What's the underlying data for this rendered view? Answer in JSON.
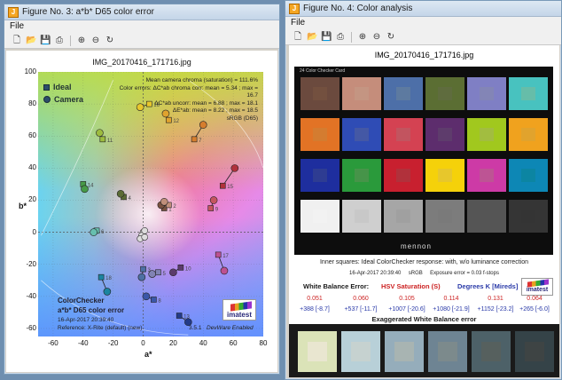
{
  "fig3": {
    "window_title": "Figure No. 3: a*b* D65 color error",
    "menu_file": "File",
    "plot_title": "IMG_20170416_171716.jpg",
    "legend_ideal": "Ideal",
    "legend_camera": "Camera",
    "info_lines": [
      "Mean camera chroma (saturation) = 111.6%",
      "Color errors:  ΔC*ab chroma corr:  mean = 5.34 ;  max = 16.7",
      "ΔC*ab uncorr:  mean = 6.88 ;  max = 18.1",
      "ΔE*ab:  mean = 8.22 ;  max = 18.5",
      "sRGB (D65)"
    ],
    "x_axis_label": "a*",
    "y_axis_label": "b*",
    "x_ticks": [
      "-60",
      "-40",
      "-20",
      "0",
      "20",
      "40",
      "60",
      "80"
    ],
    "y_ticks": [
      "100",
      "80",
      "60",
      "40",
      "20",
      "0",
      "-20",
      "-40",
      "-60"
    ],
    "cc_title": "ColorChecker",
    "cc_subtitle": "a*b* D65 color error",
    "cc_date": "16-Apr-2017 20:39:40",
    "cc_ref": "Reference: X-Rite (default) (new)",
    "version": "3.5.1",
    "devware": "DevWare Enabled",
    "logo_text": "imatest",
    "chart_data": {
      "type": "scatter",
      "title": "IMG_20170416_171716.jpg",
      "xlabel": "a*",
      "ylabel": "b*",
      "xlim": [
        -70,
        80
      ],
      "ylim": [
        -65,
        100
      ],
      "points": [
        {
          "label": "1",
          "ideal": [
            14,
            15
          ],
          "camera": [
            12,
            17
          ],
          "color": "#7a5240"
        },
        {
          "label": "2",
          "ideal": [
            17,
            17
          ],
          "camera": [
            14,
            19
          ],
          "color": "#c08f7a"
        },
        {
          "label": "3",
          "ideal": [
            0,
            -23
          ],
          "camera": [
            -1,
            -28
          ],
          "color": "#4d6fa3"
        },
        {
          "label": "4",
          "ideal": [
            -13,
            22
          ],
          "camera": [
            -15,
            24
          ],
          "color": "#5b6b35"
        },
        {
          "label": "5",
          "ideal": [
            10,
            -25
          ],
          "camera": [
            6,
            -26
          ],
          "color": "#8183b3"
        },
        {
          "label": "6",
          "ideal": [
            -31,
            1
          ],
          "camera": [
            -33,
            0
          ],
          "color": "#67bfae"
        },
        {
          "label": "7",
          "ideal": [
            34,
            58
          ],
          "camera": [
            40,
            67
          ],
          "color": "#d67e2e"
        },
        {
          "label": "8",
          "ideal": [
            7,
            -42
          ],
          "camera": [
            2,
            -40
          ],
          "color": "#3b57a8"
        },
        {
          "label": "9",
          "ideal": [
            45,
            15
          ],
          "camera": [
            47,
            20
          ],
          "color": "#c4555f"
        },
        {
          "label": "10",
          "ideal": [
            25,
            -22
          ],
          "camera": [
            20,
            -25
          ],
          "color": "#5b3b6b"
        },
        {
          "label": "11",
          "ideal": [
            -27,
            58
          ],
          "camera": [
            -29,
            62
          ],
          "color": "#9dbc3f"
        },
        {
          "label": "12",
          "ideal": [
            17,
            70
          ],
          "camera": [
            15,
            74
          ],
          "color": "#e0a32e"
        },
        {
          "label": "13",
          "ideal": [
            24,
            -52
          ],
          "camera": [
            30,
            -56
          ],
          "color": "#233b8a"
        },
        {
          "label": "14",
          "ideal": [
            -40,
            30
          ],
          "camera": [
            -39,
            27
          ],
          "color": "#479a48"
        },
        {
          "label": "15",
          "ideal": [
            53,
            29
          ],
          "camera": [
            61,
            40
          ],
          "color": "#b0323b"
        },
        {
          "label": "16",
          "ideal": [
            4,
            80
          ],
          "camera": [
            -2,
            78
          ],
          "color": "#e8c72c"
        },
        {
          "label": "17",
          "ideal": [
            50,
            -14
          ],
          "camera": [
            54,
            -24
          ],
          "color": "#bd5191"
        },
        {
          "label": "18",
          "ideal": [
            -28,
            -28
          ],
          "camera": [
            -24,
            -37
          ],
          "color": "#1b85a0"
        }
      ],
      "grid": true
    }
  },
  "fig4": {
    "window_title": "Figure No. 4: Color analysis",
    "menu_file": "File",
    "plot_title": "IMG_20170416_171716.jpg",
    "card_label": "24 Color Checker Card",
    "brand": "mennon",
    "patches": [
      {
        "outer": "#6b4a3e",
        "inner": "#73503f"
      },
      {
        "outer": "#c58d7b",
        "inner": "#c49582"
      },
      {
        "outer": "#4d6fa8",
        "inner": "#5d7aa0"
      },
      {
        "outer": "#5b6e33",
        "inner": "#5f6c3e"
      },
      {
        "outer": "#7f7fc4",
        "inner": "#8385b6"
      },
      {
        "outer": "#48c2bf",
        "inner": "#66bda9"
      },
      {
        "outer": "#e27325",
        "inner": "#d47c30"
      },
      {
        "outer": "#2f4cb5",
        "inner": "#4458a5"
      },
      {
        "outer": "#d44252",
        "inner": "#c2545f"
      },
      {
        "outer": "#5d2d6d",
        "inner": "#5e3c6c"
      },
      {
        "outer": "#a1c81e",
        "inner": "#a2bd40"
      },
      {
        "outer": "#f0a21e",
        "inner": "#e1a32d"
      },
      {
        "outer": "#1e2e9e",
        "inner": "#2e3c92"
      },
      {
        "outer": "#2a9a3b",
        "inner": "#469449"
      },
      {
        "outer": "#c8202f",
        "inner": "#b1313b"
      },
      {
        "outer": "#f5d10a",
        "inner": "#e7c72c"
      },
      {
        "outer": "#cd3aa6",
        "inner": "#bd5494"
      },
      {
        "outer": "#0d87b5",
        "inner": "#0c85a2"
      },
      {
        "outer": "#f0f0f0",
        "inner": "#f2f2f2"
      },
      {
        "outer": "#cfcfcf",
        "inner": "#c8c8c8"
      },
      {
        "outer": "#a6a6a6",
        "inner": "#a0a0a0"
      },
      {
        "outer": "#7c7c7c",
        "inner": "#7a7a7a"
      },
      {
        "outer": "#555555",
        "inner": "#555555"
      },
      {
        "outer": "#353535",
        "inner": "#343434"
      }
    ],
    "inner_squares_text": "Inner squares: Ideal ColorChecker response: with, w/o luminance correction",
    "date_text": "16-Apr-2017 20:39:40",
    "srgb_text": "sRGB",
    "exposure_text": "Exposure error = 0.03 f-stops",
    "wb_error_label": "White Balance Error:",
    "hsv_label": "HSV Saturation (S)",
    "degrees_label": "Degrees K [Mireds]",
    "logo_text": "imatest",
    "wb_values_row1": [
      "0.051",
      "0.060",
      "0.105",
      "0.114",
      "0.131",
      "0.064"
    ],
    "wb_values_row2": [
      "+388 [-8.7]",
      "+537 [-11.7]",
      "+1007 [-20.6]",
      "+1080 [-21.9]",
      "+1152 [-23.2]",
      "+265 [-6.0]"
    ],
    "exaggerated_title": "Exaggerated White Balance error",
    "exag_patches": [
      {
        "outer": "#dbe3b8",
        "inner": "#e9e6d0"
      },
      {
        "outer": "#b8d0d8",
        "inner": "#c6d2d0"
      },
      {
        "outer": "#95adbb",
        "inner": "#a8b4b2"
      },
      {
        "outer": "#6e8493",
        "inner": "#7c8a8c"
      },
      {
        "outer": "#4d6168",
        "inner": "#56605e"
      },
      {
        "outer": "#354348",
        "inner": "#3e4444"
      }
    ],
    "colors": {
      "wb_red": "#cc2222",
      "wb_blue": "#2a3aa8",
      "wb_dark": "#1a1a1a"
    }
  }
}
